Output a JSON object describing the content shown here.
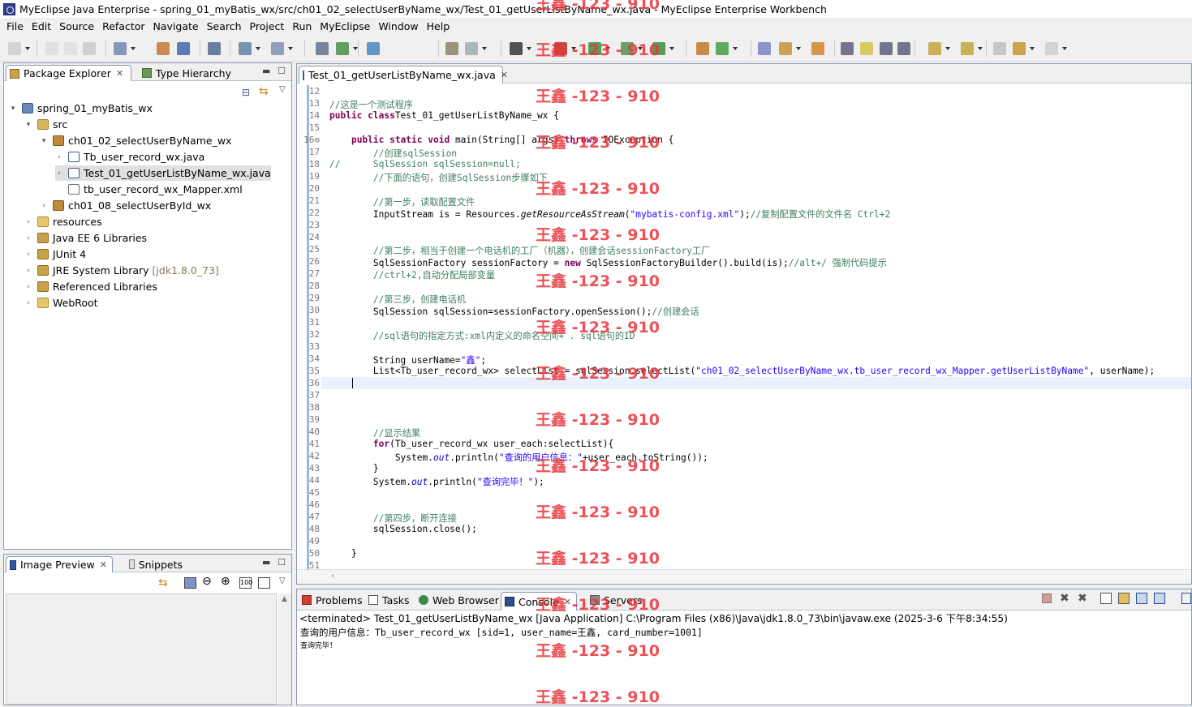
{
  "window": {
    "title": "MyEclipse Java Enterprise - spring_01_myBatis_wx/src/ch01_02_selectUserByName_wx/Test_01_getUserListByName_wx.java - MyEclipse Enterprise Workbench"
  },
  "menu": [
    "File",
    "Edit",
    "Source",
    "Refactor",
    "Navigate",
    "Search",
    "Project",
    "Run",
    "MyEclipse",
    "Window",
    "Help"
  ],
  "explorer": {
    "tabs": [
      "Package Explorer",
      "Type Hierarchy"
    ],
    "tree": [
      {
        "label": "spring_01_myBatis_wx",
        "icon": "project-icon",
        "twisty": "▾",
        "indent": 0
      },
      {
        "label": "src",
        "icon": "source-folder-icon",
        "twisty": "▾",
        "indent": 1
      },
      {
        "label": "ch01_02_selectUserByName_wx",
        "icon": "package-icon",
        "twisty": "▾",
        "indent": 2
      },
      {
        "label": "Tb_user_record_wx.java",
        "icon": "java-file-icon",
        "twisty": "›",
        "indent": 3
      },
      {
        "label": "Test_01_getUserListByName_wx.java",
        "icon": "java-file-icon",
        "twisty": "›",
        "indent": 3,
        "selected": true
      },
      {
        "label": "tb_user_record_wx_Mapper.xml",
        "icon": "xml-file-icon",
        "twisty": "",
        "indent": 3
      },
      {
        "label": "ch01_08_selectUserById_wx",
        "icon": "package-icon",
        "twisty": "›",
        "indent": 2
      },
      {
        "label": "resources",
        "icon": "folder-icon",
        "twisty": "›",
        "indent": 1
      },
      {
        "label": "Java EE 6 Libraries",
        "icon": "library-icon",
        "twisty": "›",
        "indent": 1
      },
      {
        "label": "JUnit 4",
        "icon": "library-icon",
        "twisty": "›",
        "indent": 1
      },
      {
        "label": "JRE System Library",
        "suffix": "[jdk1.8.0_73]",
        "icon": "library-icon",
        "twisty": "›",
        "indent": 1
      },
      {
        "label": "Referenced Libraries",
        "icon": "library-icon",
        "twisty": "›",
        "indent": 1
      },
      {
        "label": "WebRoot",
        "icon": "folder-icon",
        "twisty": "›",
        "indent": 1
      }
    ]
  },
  "image_preview": {
    "tabs": [
      "Image Preview",
      "Snippets"
    ]
  },
  "editor": {
    "tab": "Test_01_getUserListByName_wx.java",
    "lines": [
      {
        "n": "12",
        "t": []
      },
      {
        "n": "13",
        "t": [
          [
            "cm",
            "//这是一个测试程序"
          ]
        ]
      },
      {
        "n": "14",
        "t": [
          [
            "kw",
            "public class"
          ],
          [
            "",
            "Test_01_getUserListByName_wx {"
          ]
        ]
      },
      {
        "n": "15",
        "t": []
      },
      {
        "n": "16⊖",
        "t": [
          [
            "",
            "    "
          ],
          [
            "kw",
            "public static void"
          ],
          [
            "",
            " main(String[] args) "
          ],
          [
            "kw",
            "throws"
          ],
          [
            "",
            " IOException {"
          ]
        ]
      },
      {
        "n": "17",
        "t": [
          [
            "",
            "        "
          ],
          [
            "cm",
            "//创建sqlSession"
          ]
        ]
      },
      {
        "n": "18",
        "t": [
          [
            "cm",
            "//      SqlSession sqlSession=null;"
          ]
        ]
      },
      {
        "n": "19",
        "t": [
          [
            "",
            "        "
          ],
          [
            "cm",
            "//下面的语句，创建SqlSession步骤如下"
          ]
        ]
      },
      {
        "n": "20",
        "t": []
      },
      {
        "n": "21",
        "t": [
          [
            "",
            "        "
          ],
          [
            "cm",
            "//第一步，读取配置文件"
          ]
        ]
      },
      {
        "n": "22",
        "t": [
          [
            "",
            "        InputStream is = Resources."
          ],
          [
            "it",
            "getResourceAsStream"
          ],
          [
            "",
            "("
          ],
          [
            "str",
            "\"mybatis-config.xml\""
          ],
          [
            "",
            ");"
          ],
          [
            "cm",
            "//复制配置文件的文件名 Ctrl+2"
          ]
        ]
      },
      {
        "n": "23",
        "t": []
      },
      {
        "n": "24",
        "t": []
      },
      {
        "n": "25",
        "t": [
          [
            "",
            "        "
          ],
          [
            "cm",
            "//第二步，相当于创建一个电话机的工厂（机器），创建会话sessionFactory工厂"
          ]
        ]
      },
      {
        "n": "26",
        "t": [
          [
            "",
            "        SqlSessionFactory sessionFactory = "
          ],
          [
            "kw",
            "new"
          ],
          [
            "",
            " SqlSessionFactoryBuilder().build(is);"
          ],
          [
            "cm",
            "//alt+/ 强制代码提示"
          ]
        ]
      },
      {
        "n": "27",
        "t": [
          [
            "",
            "        "
          ],
          [
            "cm",
            "//ctrl+2,自动分配局部变量"
          ]
        ]
      },
      {
        "n": "28",
        "t": []
      },
      {
        "n": "29",
        "t": [
          [
            "",
            "        "
          ],
          [
            "cm",
            "//第三步，创建电话机"
          ]
        ]
      },
      {
        "n": "30",
        "t": [
          [
            "",
            "        SqlSession sqlSession=sessionFactory.openSession();"
          ],
          [
            "cm",
            "//创建会话"
          ]
        ]
      },
      {
        "n": "31",
        "t": []
      },
      {
        "n": "32",
        "t": [
          [
            "",
            "        "
          ],
          [
            "cm",
            "//sql语句的指定方式:xml内定义的命名空间+ . sql语句的ID"
          ]
        ]
      },
      {
        "n": "33",
        "t": []
      },
      {
        "n": "34",
        "t": [
          [
            "",
            "        String userName="
          ],
          [
            "str",
            "\"鑫\""
          ],
          [
            "",
            ";"
          ]
        ]
      },
      {
        "n": "35",
        "t": [
          [
            "",
            "        List<Tb_user_record_wx> selectList = sqlSession.selectList("
          ],
          [
            "str",
            "\"ch01_02_selectUserByName_wx.tb_user_record_wx_Mapper.getUserListByName\""
          ],
          [
            "",
            ", userName);"
          ]
        ]
      },
      {
        "n": "36",
        "t": []
      },
      {
        "n": "37",
        "t": []
      },
      {
        "n": "38",
        "t": []
      },
      {
        "n": "39",
        "t": []
      },
      {
        "n": "40",
        "t": [
          [
            "",
            "        "
          ],
          [
            "cm",
            "//显示结果"
          ]
        ]
      },
      {
        "n": "41",
        "t": [
          [
            "",
            "        "
          ],
          [
            "kw",
            "for"
          ],
          [
            "",
            "(Tb_user_record_wx user_each:selectList){"
          ]
        ]
      },
      {
        "n": "42",
        "t": [
          [
            "",
            "            System."
          ],
          [
            "fld",
            "out"
          ],
          [
            "",
            ".println("
          ],
          [
            "str",
            "\"查询的用户信息：\""
          ],
          [
            "",
            "+user_each.toString());"
          ]
        ]
      },
      {
        "n": "43",
        "t": [
          [
            "",
            "        }"
          ]
        ]
      },
      {
        "n": "44",
        "t": [
          [
            "",
            "        System."
          ],
          [
            "fld",
            "out"
          ],
          [
            "",
            ".println("
          ],
          [
            "str",
            "\"查询完毕！\""
          ],
          [
            "",
            ");"
          ]
        ]
      },
      {
        "n": "45",
        "t": []
      },
      {
        "n": "46",
        "t": []
      },
      {
        "n": "47",
        "t": [
          [
            "",
            "        "
          ],
          [
            "cm",
            "//第四步，断开连接"
          ]
        ]
      },
      {
        "n": "48",
        "t": [
          [
            "",
            "        sqlSession.close();"
          ]
        ]
      },
      {
        "n": "49",
        "t": []
      },
      {
        "n": "50",
        "t": [
          [
            "",
            "    }"
          ]
        ]
      },
      {
        "n": "51",
        "t": []
      }
    ]
  },
  "console": {
    "tabs": [
      "Problems",
      "Tasks",
      "Web Browser",
      "Console",
      "Servers"
    ],
    "header": "<terminated> Test_01_getUserListByName_wx [Java Application] C:\\Program Files (x86)\\Java\\jdk1.8.0_73\\bin\\javaw.exe (2025-3-6 下午8:34:55)",
    "output": [
      "查询的用户信息：Tb_user_record_wx [sid=1, user_name=王鑫, card_number=1001]",
      "查询完毕！"
    ]
  },
  "watermark": "王鑫 -123 - 910",
  "colors": {
    "keyword": "#7f0055",
    "comment": "#3f7f5f",
    "string": "#2a00ff",
    "watermark": "#e8343a"
  }
}
